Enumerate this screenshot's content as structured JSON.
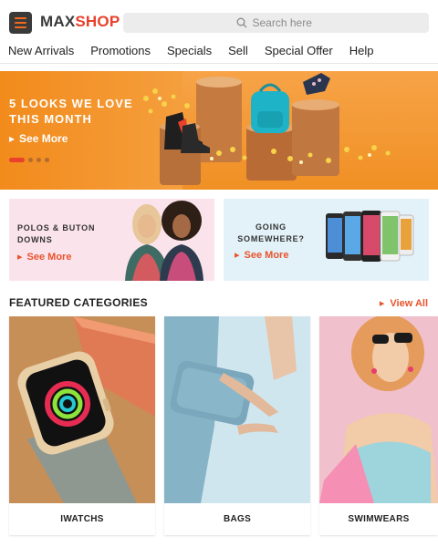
{
  "header": {
    "logo_part1": "MAX",
    "logo_part2": "SHOP",
    "search_placeholder": "Search here",
    "nav": [
      "New Arrivals",
      "Promotions",
      "Specials",
      "Sell",
      "Special Offer",
      "Help"
    ]
  },
  "hero": {
    "title": "5 LOOKS WE LOVE THIS MONTH",
    "cta": "See More",
    "slide_count": 4,
    "active_slide": 1
  },
  "promos": [
    {
      "title": "POLOS & BUTON DOWNS",
      "cta": "See More"
    },
    {
      "title": "GOING SOMEWHERE?",
      "cta": "See More"
    }
  ],
  "featured": {
    "title": "FEATURED CATEGORIES",
    "view_all": "View All",
    "categories": [
      "IWATCHS",
      "BAGS",
      "SWIMWEARS"
    ]
  },
  "colors": {
    "accent": "#e8412c",
    "orange": "#f39a34",
    "dark": "#3a3a3a"
  }
}
